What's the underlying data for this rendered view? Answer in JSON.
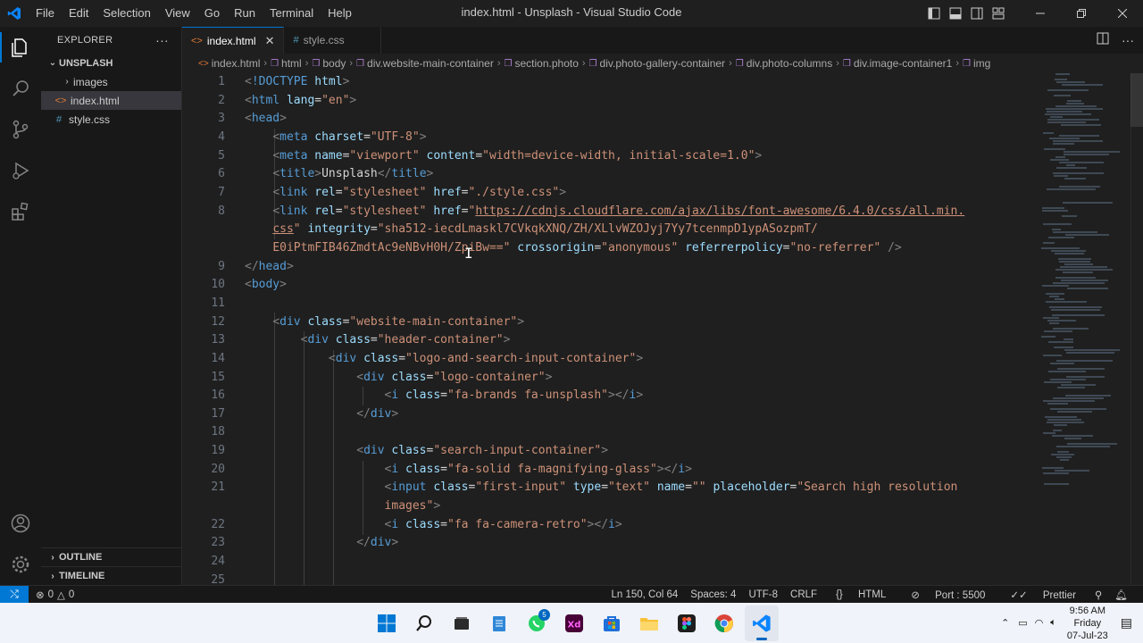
{
  "titlebar": {
    "title": "index.html - Unsplash - Visual Studio Code",
    "menu": [
      "File",
      "Edit",
      "Selection",
      "View",
      "Go",
      "Run",
      "Terminal",
      "Help"
    ]
  },
  "sidebar": {
    "header": "EXPLORER",
    "root": "UNSPLASH",
    "items": [
      {
        "label": "images",
        "type": "folder"
      },
      {
        "label": "index.html",
        "type": "html",
        "selected": true
      },
      {
        "label": "style.css",
        "type": "css"
      }
    ],
    "outline": "OUTLINE",
    "timeline": "TIMELINE"
  },
  "tabs": [
    {
      "label": "index.html",
      "active": true
    },
    {
      "label": "style.css",
      "active": false
    }
  ],
  "breadcrumbs": [
    "index.html",
    "html",
    "body",
    "div.website-main-container",
    "section.photo",
    "div.photo-gallery-container",
    "div.photo-columns",
    "div.image-container1",
    "img"
  ],
  "editor": {
    "line_numbers": [
      "1",
      "2",
      "3",
      "4",
      "5",
      "6",
      "7",
      "8",
      "",
      "",
      "9",
      "10",
      "11",
      "12",
      "13",
      "14",
      "15",
      "16",
      "17",
      "18",
      "19",
      "20",
      "21",
      "",
      "22",
      "23",
      "24",
      "25"
    ]
  },
  "statusbar": {
    "problems": "0",
    "warnings": "0",
    "position": "Ln 150, Col 64",
    "spaces": "Spaces: 4",
    "encoding": "UTF-8",
    "eol": "CRLF",
    "language": "HTML",
    "port": "Port : 5500",
    "formatter": "Prettier"
  },
  "taskbar": {
    "time": "9:56 AM",
    "day": "Friday",
    "date": "07-Jul-23",
    "whatsapp_badge": "5"
  }
}
